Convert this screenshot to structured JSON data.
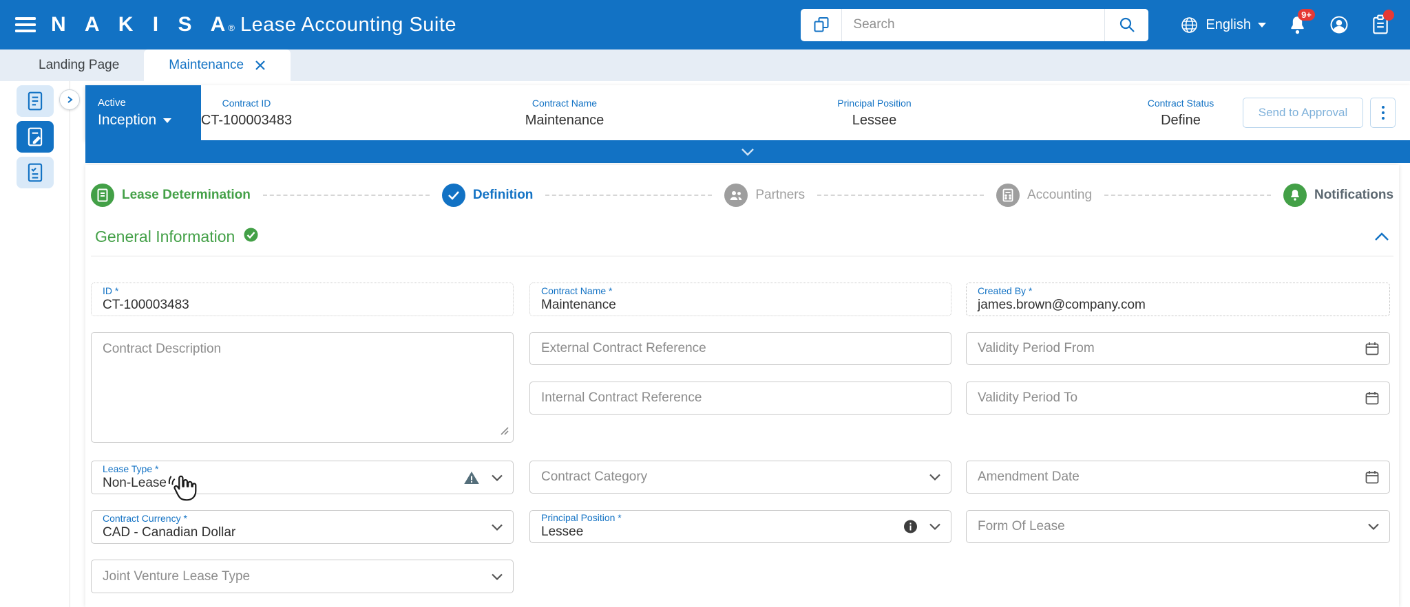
{
  "colors": {
    "accent": "#1272C4",
    "green": "#43A047",
    "badge_red": "#E53935"
  },
  "header": {
    "brand": "N A K I S A",
    "registered": "®",
    "product": "Lease Accounting Suite",
    "search": {
      "placeholder": "Search"
    },
    "language": {
      "label": "English"
    },
    "notifications_badge": "9+"
  },
  "tabs": {
    "landing": "Landing Page",
    "maintenance": "Maintenance"
  },
  "contract_bar": {
    "status": "Active",
    "phase": "Inception",
    "contract_id_label": "Contract ID",
    "contract_id": "CT-100003483",
    "contract_name_label": "Contract Name",
    "contract_name": "Maintenance",
    "principal_position_label": "Principal Position",
    "principal_position": "Lessee",
    "contract_status_label": "Contract Status",
    "contract_status": "Define",
    "send_to_approval": "Send to Approval"
  },
  "stepper": {
    "lease_determination": "Lease Determination",
    "definition": "Definition",
    "partners": "Partners",
    "accounting": "Accounting",
    "notifications": "Notifications"
  },
  "section": {
    "title": "General Information"
  },
  "form": {
    "id_label": "ID *",
    "id_value": "CT-100003483",
    "contract_name_label": "Contract Name *",
    "contract_name_value": "Maintenance",
    "created_by_label": "Created By *",
    "created_by_value": "james.brown@company.com",
    "contract_description_ph": "Contract Description",
    "external_ref_ph": "External Contract Reference",
    "validity_from_ph": "Validity Period From",
    "internal_ref_ph": "Internal Contract Reference",
    "validity_to_ph": "Validity Period To",
    "lease_type_label": "Lease Type *",
    "lease_type_value": "Non-Lease",
    "contract_category_ph": "Contract Category",
    "amendment_date_ph": "Amendment Date",
    "contract_currency_label": "Contract Currency *",
    "contract_currency_value": "CAD - Canadian Dollar",
    "principal_position_label": "Principal Position *",
    "principal_position_value": "Lessee",
    "form_of_lease_ph": "Form Of Lease",
    "joint_venture_ph": "Joint Venture Lease Type"
  }
}
